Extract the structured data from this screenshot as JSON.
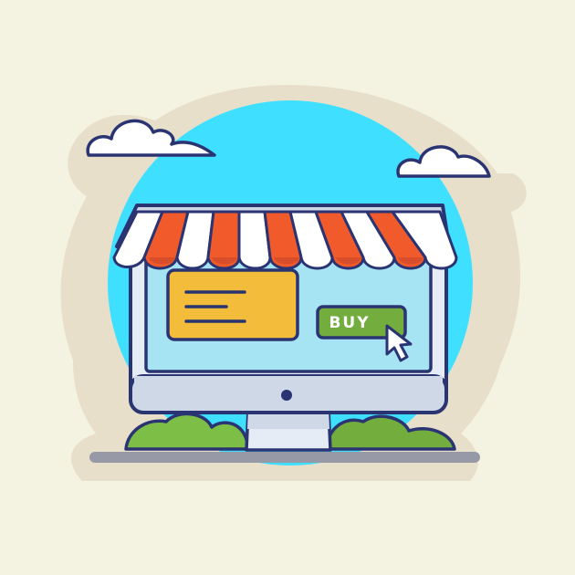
{
  "screen": {
    "buy_button_label": "BUY"
  },
  "colors": {
    "background": "#f4f2e1",
    "sticker_border": "#e7dfc9",
    "sky": "#3fe0ff",
    "outline": "#2b3472",
    "screen": "#a6e4f4",
    "monitor_frame": "#e6ecf5",
    "monitor_bezel": "#cfd8e6",
    "awning_red": "#f15a2b",
    "awning_white": "#ffffff",
    "card_yellow": "#f3bd3b",
    "button_green": "#73ad3e",
    "bush_green": "#7dbe46",
    "shadow": "#979aa6"
  },
  "icons": [
    "cloud-icon",
    "cursor-arrow-icon",
    "power-dot-icon",
    "text-lines-icon"
  ]
}
